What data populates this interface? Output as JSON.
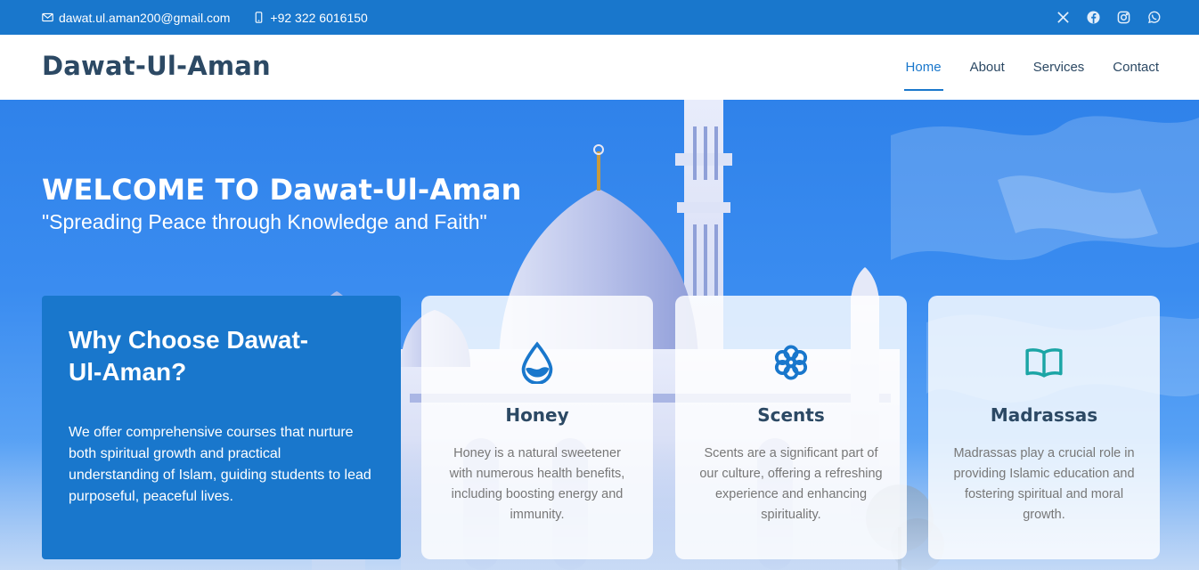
{
  "topbar": {
    "email": "dawat.ul.aman200@gmail.com",
    "phone": "+92 322 6016150",
    "email_icon": "envelope-icon",
    "phone_icon": "phone-icon",
    "social": [
      "x-twitter-icon",
      "facebook-icon",
      "instagram-icon",
      "whatsapp-icon"
    ]
  },
  "header": {
    "logo": "Dawat-Ul-Aman",
    "nav": [
      {
        "label": "Home",
        "active": true
      },
      {
        "label": "About"
      },
      {
        "label": "Services"
      },
      {
        "label": "Contact"
      }
    ]
  },
  "hero": {
    "title": "WELCOME TO Dawat-Ul-Aman",
    "tagline": "\"Spreading Peace through Knowledge and Faith\""
  },
  "why": {
    "title": "Why Choose Dawat-Ul-Aman?",
    "text": "We offer comprehensive courses that nurture both spiritual growth and practical understanding of Islam, guiding students to lead purposeful, peaceful lives."
  },
  "cards": [
    {
      "icon": "droplet-icon",
      "title": "Honey",
      "text": "Honey is a natural sweetener with numerous health benefits, including boosting energy and immunity."
    },
    {
      "icon": "flower-icon",
      "title": "Scents",
      "text": "Scents are a significant part of our culture, offering a refreshing experience and enhancing spirituality."
    },
    {
      "icon": "book-icon",
      "title": "Madrassas",
      "text": "Madrassas play a crucial role in providing Islamic education and fostering spiritual and moral growth."
    }
  ],
  "colors": {
    "primary": "#1977cc",
    "heading": "#2c4964",
    "teal_icon": "#1ba5a5"
  }
}
